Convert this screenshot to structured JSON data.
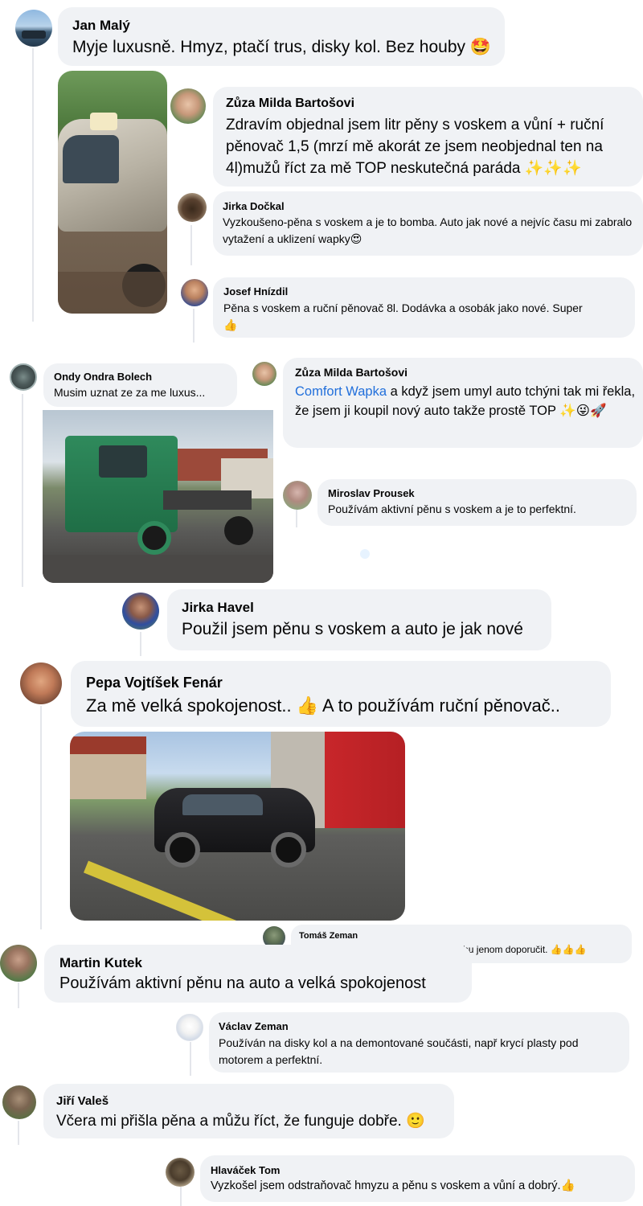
{
  "comments": [
    {
      "id": "jan",
      "name": "Jan Malý",
      "text": "Myje luxusně. Hmyz, ptačí trus, disky kol. Bez houby",
      "emoji": "🤩"
    },
    {
      "id": "zuza1",
      "name": "Zůza Milda Bartošovi",
      "text": "Zdravím objednal jsem litr pěny s voskem a vůní + ruční pěnovač 1,5 (mrzí mě akorát ze jsem neobjednal ten na 4l)mužů říct za mě TOP neskutečná paráda",
      "emoji": "✨✨✨"
    },
    {
      "id": "jirka-d",
      "name": "Jirka Dočkal",
      "text": "Vyzkoušeno-pěna s voskem a je to bomba. Auto jak nové a nejvíc času mi zabralo vytažení a uklizení wapky",
      "emoji": "😍"
    },
    {
      "id": "josef",
      "name": "Josef Hnízdil",
      "text": "Pěna s voskem a ruční pěnovač 8l. Dodávka a osobák jako nové. Super",
      "emoji": "👍"
    },
    {
      "id": "ondy",
      "name": "Ondy Ondra Bolech",
      "text": "Musim uznat ze za me luxus..."
    },
    {
      "id": "zuza2",
      "name": "Zůza Milda Bartošovi",
      "mention": "Comfort Wapka",
      "text": " a když jsem umyl auto tchýni tak mi řekla, že jsem ji koupil nový auto takže prostě TOP",
      "emoji": "✨😜🚀"
    },
    {
      "id": "miroslav",
      "name": "Miroslav Prousek",
      "text": "Používám aktivní pěnu s voskem a je to perfektní."
    },
    {
      "id": "jirka-h",
      "name": "Jirka Havel",
      "text": "Použil jsem pěnu s voskem a auto je jak nové"
    },
    {
      "id": "pepa",
      "name": "Pepa Vojtíšek Fenár",
      "text": "Za mě velká spokojenost..",
      "emoji": "👍",
      "text2": " A to používám ruční pěnovač.."
    },
    {
      "id": "tomas",
      "name": "Tomáš Zeman",
      "text": "Používám a naprostá spokojenost. Mohu jenom doporučit.",
      "emoji": "👍👍👍"
    },
    {
      "id": "martin",
      "name": "Martin Kutek",
      "text": "Používám aktivní pěnu na auto a velká spokojenost"
    },
    {
      "id": "vaclav",
      "name": "Václav Zeman",
      "text": "Používán na disky kol a na demontované součásti, např krycí plasty pod motorem a perfektní."
    },
    {
      "id": "jiri",
      "name": "Jiří Valeš",
      "text": "Včera mi přišla pěna a můžu říct, že funguje dobře.",
      "emoji": "🙂"
    },
    {
      "id": "tom",
      "name": "Hlaváček Tom",
      "text": "Vyzkošel jsem odstraňovač hmyzu a pěnu s voskem a vůní a dobrý.",
      "emoji": "👍"
    }
  ],
  "colors": {
    "bubble": "#f0f2f5",
    "mention": "#216fdb",
    "thread": "#e4e6eb"
  }
}
